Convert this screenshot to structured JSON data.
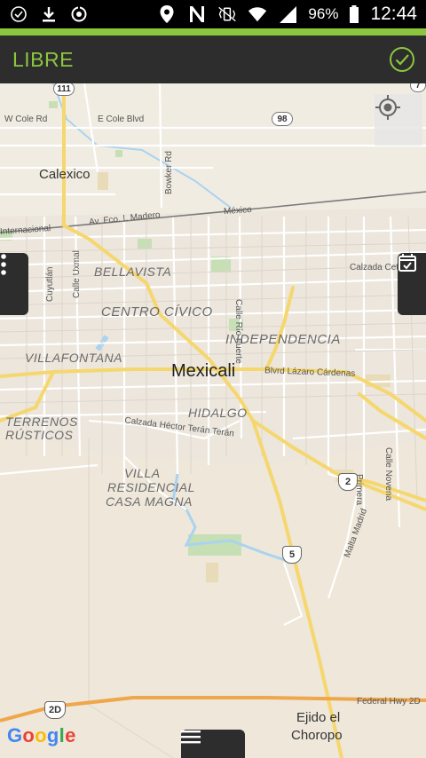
{
  "status_bar": {
    "left_icons": [
      "check-circle-icon",
      "download-icon",
      "sync-icon"
    ],
    "right_icons": [
      "location-pin-icon",
      "nfc-icon",
      "vibrate-icon",
      "wifi-icon",
      "signal-icon"
    ],
    "battery_percent": "96%",
    "time": "12:44"
  },
  "app_bar": {
    "title": "LIBRE",
    "accent_color": "#8cc63f",
    "bar_color": "#2d2d2d"
  },
  "map": {
    "city": "Mexicali",
    "towns": [
      "Calexico",
      "Ejido el",
      "Choropo"
    ],
    "districts": [
      "BELLAVISTA",
      "CENTRO CÍVICO",
      "INDEPENDENCIA",
      "VILLAFONTANA",
      "HIDALGO",
      "TERRENOS",
      "RÚSTICOS",
      "VILLA",
      "RESIDENCIAL",
      "CASA MAGNA"
    ],
    "streets": {
      "w_cole": "W Cole Rd",
      "e_cole": "E Cole Blvd",
      "bowker": "Bowker Rd",
      "madero": "Av. Fco. I. Madero",
      "mexico": "México",
      "internacional": "Internacional",
      "cuyutlan": "Cuyutlán",
      "uxmal": "Calle Uxmal",
      "rio_fuerte": "Calle Río Fuerte",
      "calzada_cet": "Calzada Cet",
      "lazaro": "Blvrd Lázaro Cárdenas",
      "hector_teran": "Calzada Héctor Terán Terán",
      "primera": "Primera",
      "calle_novena": "Calle Novena",
      "malta_madrid": "Malta Madrid",
      "federal_hwy": "Federal Hwy 2D"
    },
    "shields": [
      "111",
      "98",
      "2",
      "5",
      "2D",
      "7"
    ],
    "attribution": "Google"
  }
}
